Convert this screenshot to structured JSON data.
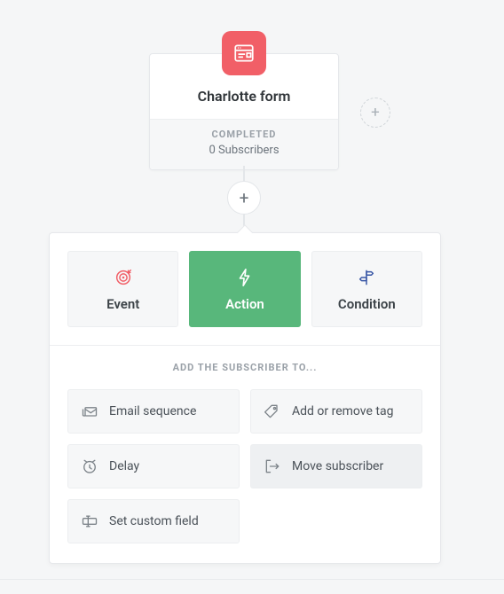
{
  "trigger": {
    "title": "Charlotte form",
    "status": "COMPLETED",
    "subscribers": "0 Subscribers"
  },
  "tabs": {
    "event": "Event",
    "action": "Action",
    "condition": "Condition"
  },
  "section_title": "ADD THE SUBSCRIBER TO...",
  "options": {
    "email_sequence": "Email sequence",
    "add_remove_tag": "Add or remove tag",
    "delay": "Delay",
    "move_subscriber": "Move subscriber",
    "set_custom_field": "Set custom field"
  }
}
